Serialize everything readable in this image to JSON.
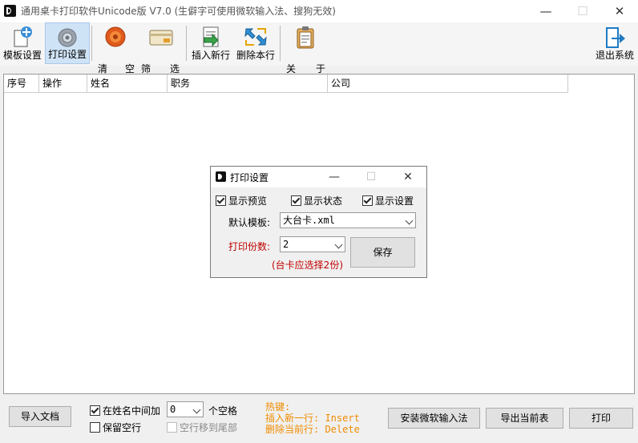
{
  "window": {
    "title": "通用桌卡打印软件Unicode版  V7.0  (生僻字可使用微软输入法、搜狗无效)",
    "minimize": "—",
    "maximize": "☐",
    "close": "✕"
  },
  "toolbar": {
    "template_settings": "模板设置",
    "print_settings": "打印设置",
    "clear_1": "清",
    "clear_2": "空",
    "filter_1": "筛",
    "filter_2": "选",
    "insert_row": "插入新行",
    "delete_row": "删除本行",
    "about_1": "关",
    "about_2": "于",
    "exit": "退出系统"
  },
  "table": {
    "columns": [
      "序号",
      "操作",
      "姓名",
      "职务",
      "公司"
    ],
    "rows": []
  },
  "dialog": {
    "title": "打印设置",
    "minimize": "—",
    "maximize": "☐",
    "close": "✕",
    "show_preview": "显示预览",
    "show_status": "显示状态",
    "show_settings": "显示设置",
    "default_template_label": "默认模板:",
    "default_template_value": "大台卡.xml",
    "copies_label": "打印份数:",
    "copies_value": "2",
    "save": "保存",
    "hint": "(台卡应选择2份)"
  },
  "bottom": {
    "import_doc": "导入文档",
    "space_in_name": "在姓名中间加",
    "space_count": "0",
    "space_unit": "个空格",
    "keep_blank": "保留空行",
    "move_blank": "空行移到尾部",
    "hotkey_title": "热键:",
    "hotkey_insert": "插入新一行: Insert",
    "hotkey_delete": "删除当前行: Delete",
    "install_ime": "安装微软输入法",
    "export": "导出当前表",
    "print": "打印"
  },
  "colors": {
    "hotkey": "#f08c00",
    "warning": "#c00000",
    "active_tool": "#cfe3f6"
  }
}
